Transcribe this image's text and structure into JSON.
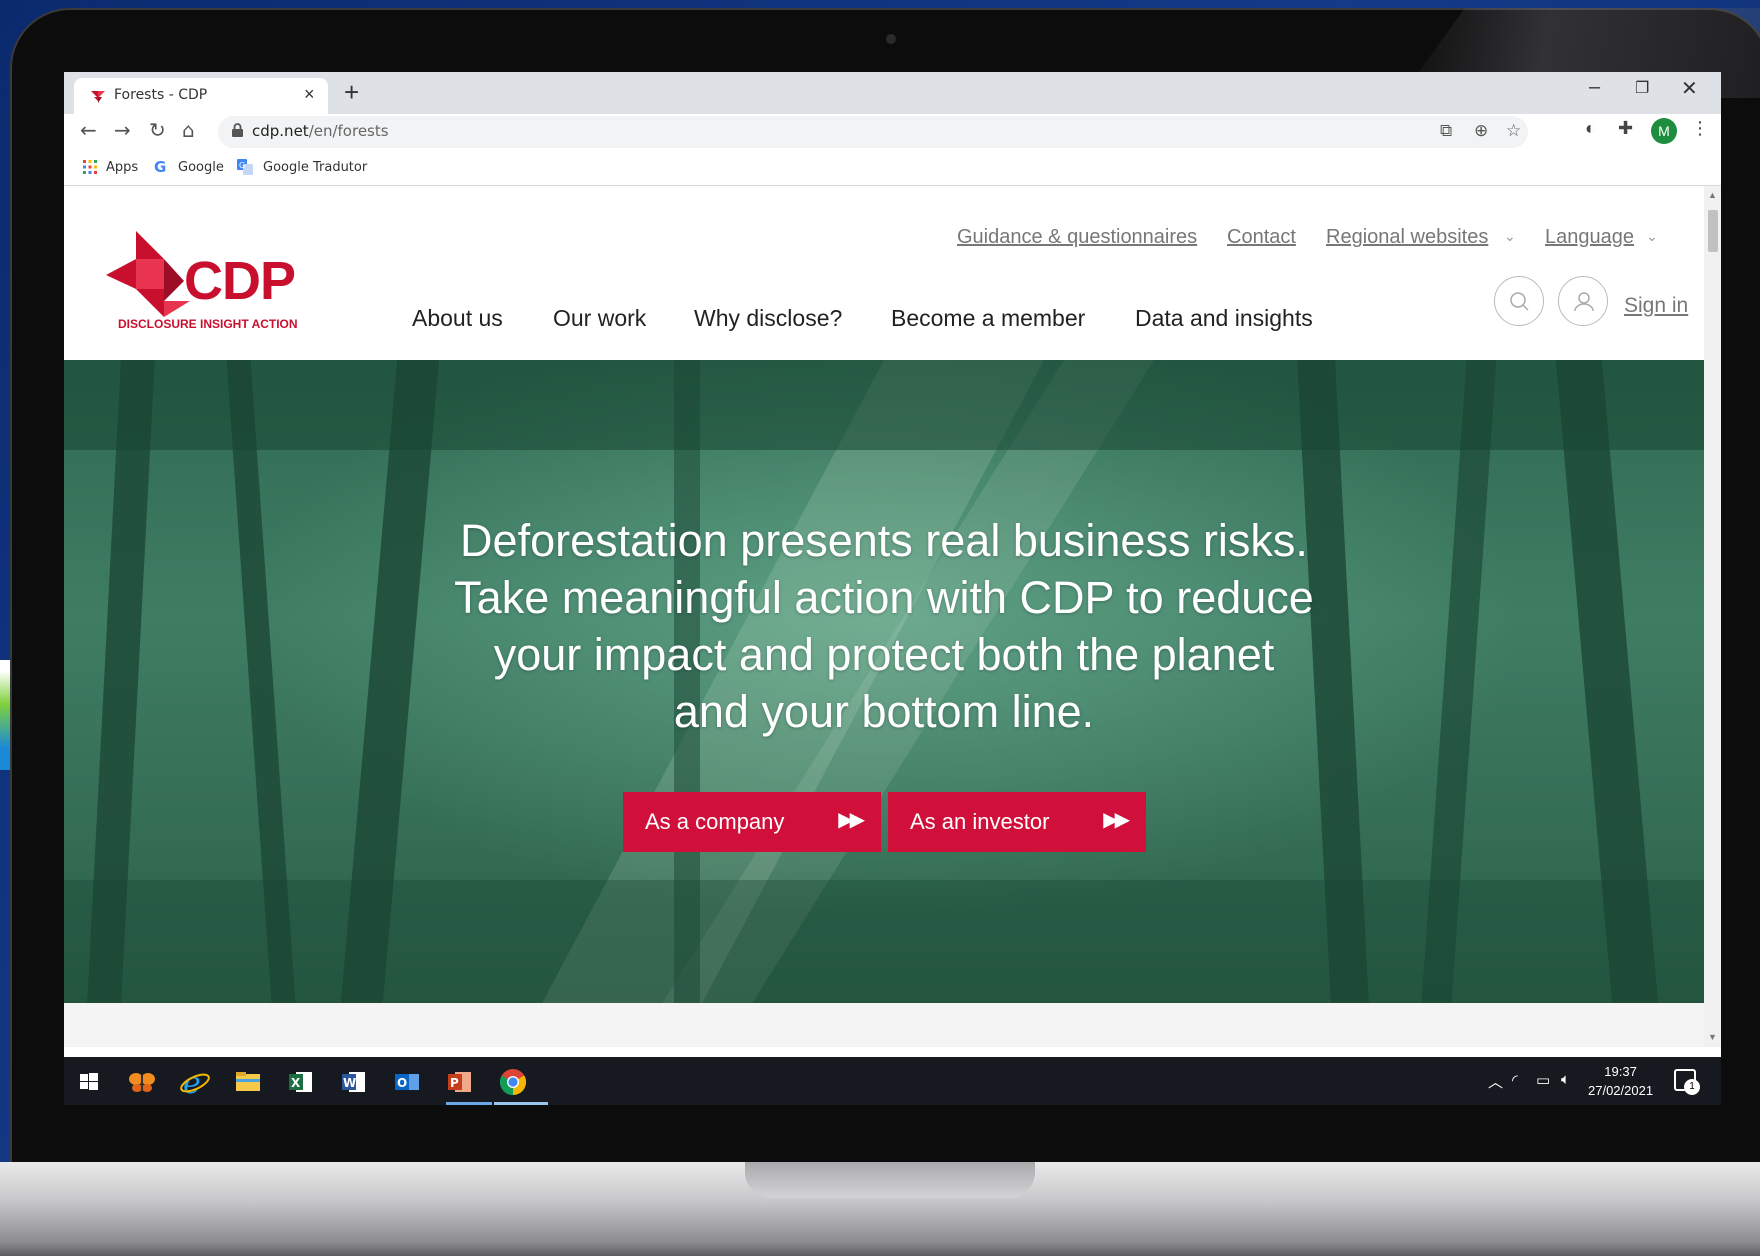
{
  "browser": {
    "tab": {
      "title": "Forests - CDP",
      "close": "×"
    },
    "new_tab": "+",
    "window_controls": {
      "minimize": "–",
      "restore": "❐",
      "close": "✕"
    },
    "url_host": "cdp.net",
    "url_path": "/en/forests",
    "profile_initial": "M",
    "bookmarks": [
      "Apps",
      "Google",
      "Google Tradutor"
    ]
  },
  "site": {
    "logo_text": "CDP",
    "logo_tagline": "DISCLOSURE INSIGHT ACTION",
    "utility_links": [
      "Guidance & questionnaires",
      "Contact",
      "Regional websites",
      "Language"
    ],
    "main_nav": [
      "About us",
      "Our work",
      "Why disclose?",
      "Become a member",
      "Data and insights"
    ],
    "sign_in": "Sign in",
    "hero_text": "Deforestation presents real business risks. Take meaningful action with CDP to reduce your impact and protect both the planet and your bottom line.",
    "cta_buttons": [
      "As a company",
      "As an investor"
    ],
    "brand_color": "#c8102e"
  },
  "taskbar": {
    "apps": [
      "start-icon",
      "butterfly-app-icon",
      "internet-explorer-icon",
      "file-explorer-icon",
      "excel-icon",
      "word-icon",
      "outlook-icon",
      "powerpoint-icon",
      "chrome-icon"
    ],
    "time": "19:37",
    "date": "27/02/2021",
    "notification_count": "1"
  }
}
